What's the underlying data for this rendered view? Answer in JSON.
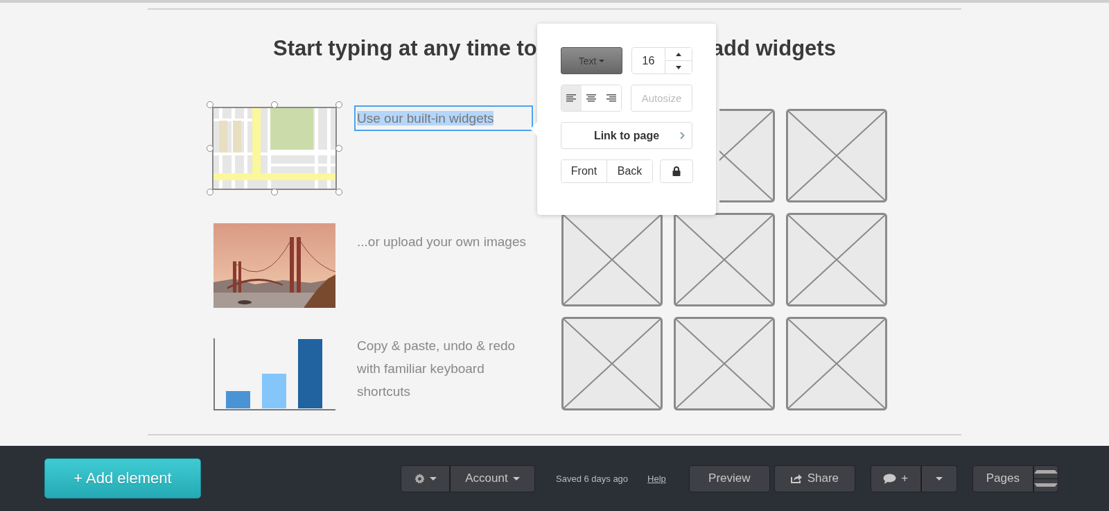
{
  "heading": {
    "left": "Start typing at any time to",
    "right": "add widgets"
  },
  "widgets": [
    {
      "kind": "map",
      "text": "Use our built-in widgets",
      "image_selected": true,
      "text_selected": true
    },
    {
      "text": "...or upload your own images",
      "image_selected": false,
      "text_selected": false
    },
    {
      "kind": "chart",
      "text": "Copy & paste, undo & redo with familiar keyboard shortcuts",
      "image_selected": false,
      "text_selected": false
    }
  ],
  "popover": {
    "type_button": "Text",
    "font_size": "16",
    "align": [
      {
        "kind": "left",
        "selected": true
      },
      {
        "kind": "center",
        "selected": false
      },
      {
        "kind": "right",
        "selected": false
      }
    ],
    "autosize": {
      "label": "Autosize",
      "disabled": true
    },
    "link": "Link to page",
    "order": [
      "Front",
      "Back"
    ]
  },
  "toolbar": {
    "add_element": "+ Add element",
    "account": "Account",
    "status": "Saved 6 days ago",
    "help": "Help",
    "preview": "Preview",
    "share": "Share",
    "comment": "+",
    "pages": "Pages"
  }
}
